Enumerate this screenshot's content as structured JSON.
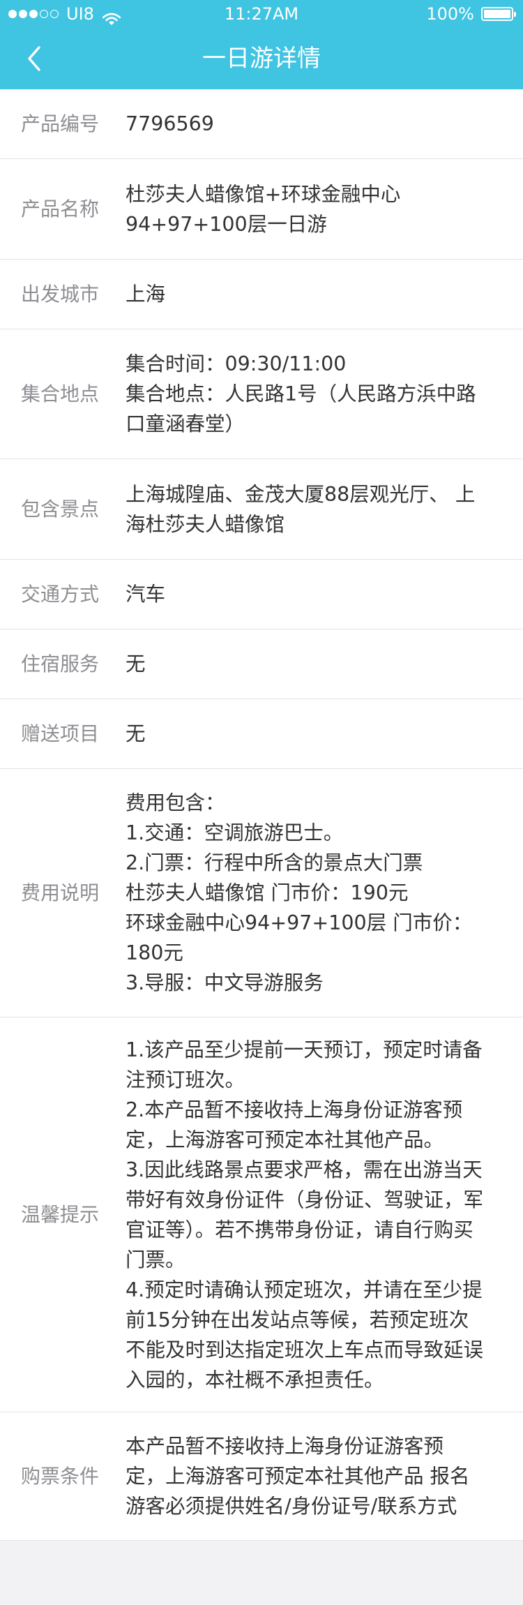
{
  "status_bar": {
    "carrier": "UI8",
    "time": "11:27AM",
    "battery": "100%",
    "battery_level": 1.0,
    "signal_bars_filled": 3,
    "signal_bars_total": 5
  },
  "nav": {
    "title": "一日游详情",
    "back_icon": "chevron-left-icon"
  },
  "details": {
    "product_id": {
      "label": "产品编号",
      "value": "7796569"
    },
    "product_name": {
      "label": "产品名称",
      "value": "杜莎夫人蜡像馆+环球金融中心\n94+97+100层一日游"
    },
    "departure_city": {
      "label": "出发城市",
      "value": "上海"
    },
    "meeting_point": {
      "label": "集合地点",
      "value": "集合时间：09:30/11:00\n集合地点：人民路1号（人民路方浜中路\n口童涵春堂）"
    },
    "attractions": {
      "label": "包含景点",
      "value": "上海城隍庙、金茂大厦88层观光厅、 上\n海杜莎夫人蜡像馆"
    },
    "transport": {
      "label": "交通方式",
      "value": "汽车"
    },
    "accommodation": {
      "label": "住宿服务",
      "value": "无"
    },
    "gifts": {
      "label": "赠送项目",
      "value": "无"
    },
    "fees": {
      "label": "费用说明",
      "value": "费用包含：\n1.交通：空调旅游巴士。\n2.门票：行程中所含的景点大门票\n杜莎夫人蜡像馆 门市价：190元\n环球金融中心94+97+100层 门市价：\n180元\n3.导服：中文导游服务"
    },
    "tips": {
      "label": "温馨提示",
      "value": "1.该产品至少提前一天预订，预定时请备\n注预订班次。\n2.本产品暂不接收持上海身份证游客预\n定，上海游客可预定本社其他产品。\n3.因此线路景点要求严格，需在出游当天\n带好有效身份证件（身份证、驾驶证，军\n官证等）。若不携带身份证，请自行购买\n门票。\n4.预定时请确认预定班次，并请在至少提\n前15分钟在出发站点等候，若预定班次\n不能及时到达指定班次上车点而导致延误\n入园的，本社概不承担责任。"
    },
    "purchase_conditions": {
      "label": "购票条件",
      "value": " 本产品暂不接收持上海身份证游客预\n定，上海游客可预定本社其他产品 报名\n游客必须提供姓名/身份证号/联系方式"
    }
  },
  "colors": {
    "header_bg": "#3fc4e2",
    "label_text": "#8e8e93",
    "value_text": "#333333",
    "divider": "#e4e4e8",
    "page_bg": "#f2f2f4"
  }
}
